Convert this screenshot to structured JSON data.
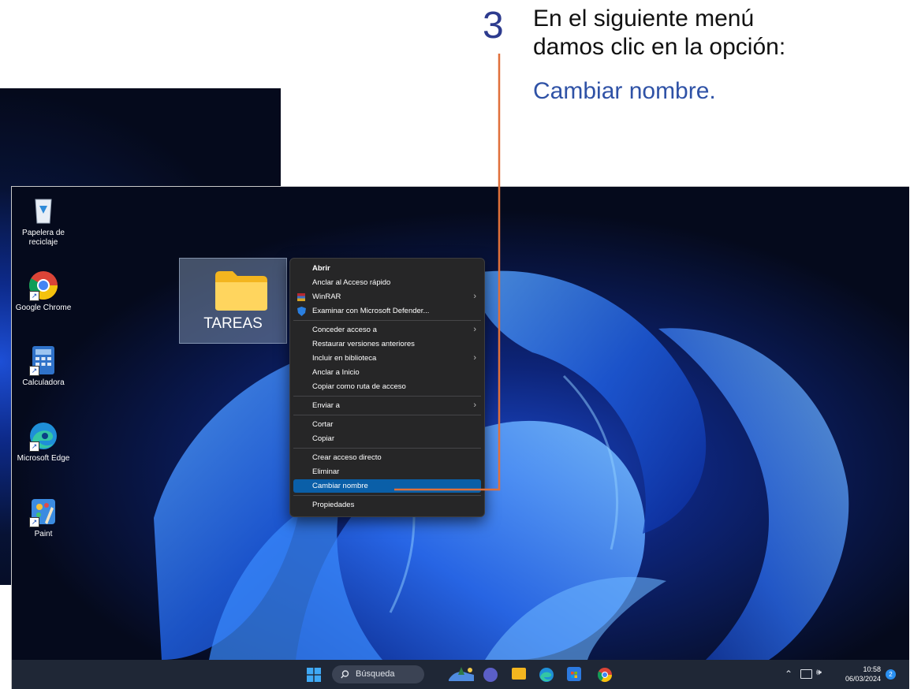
{
  "instruction": {
    "step_number": "3",
    "line1": "En el siguiente menú",
    "line2": "damos clic en la opción:",
    "line3": "Cambiar nombre."
  },
  "desktop_icons": [
    {
      "label": "Papelera de reciclaje",
      "icon": "recycle-bin-icon"
    },
    {
      "label": "Google Chrome",
      "icon": "chrome-icon"
    },
    {
      "label": "Calculadora",
      "icon": "calculator-icon"
    },
    {
      "label": "Microsoft Edge",
      "icon": "edge-icon"
    },
    {
      "label": "Paint",
      "icon": "paint-icon"
    }
  ],
  "folder": {
    "label": "TAREAS",
    "icon": "folder-icon"
  },
  "context_menu": {
    "items": [
      {
        "label": "Abrir"
      },
      {
        "label": "Anclar al Acceso rápido"
      },
      {
        "label": "WinRAR"
      },
      {
        "label": "Examinar con Microsoft Defender..."
      },
      {
        "label": "Conceder acceso a"
      },
      {
        "label": "Restaurar versiones anteriores"
      },
      {
        "label": "Incluir en biblioteca"
      },
      {
        "label": "Anclar a Inicio"
      },
      {
        "label": "Copiar como ruta de acceso"
      },
      {
        "label": "Enviar a"
      },
      {
        "label": "Cortar"
      },
      {
        "label": "Copiar"
      },
      {
        "label": "Crear acceso directo"
      },
      {
        "label": "Eliminar"
      },
      {
        "label": "Cambiar nombre"
      },
      {
        "label": "Propiedades"
      }
    ],
    "highlighted": "Cambiar nombre"
  },
  "taskbar": {
    "search_label": "Búsqueda",
    "time": "10:58",
    "date": "06/03/2024",
    "notification_count": "2"
  },
  "colors": {
    "accent": "#0a5fa8",
    "pointer": "#e0703a",
    "instruction_blue": "#2f52a6",
    "menu_bg": "#262627",
    "taskbar_bg": "#1f2736"
  }
}
